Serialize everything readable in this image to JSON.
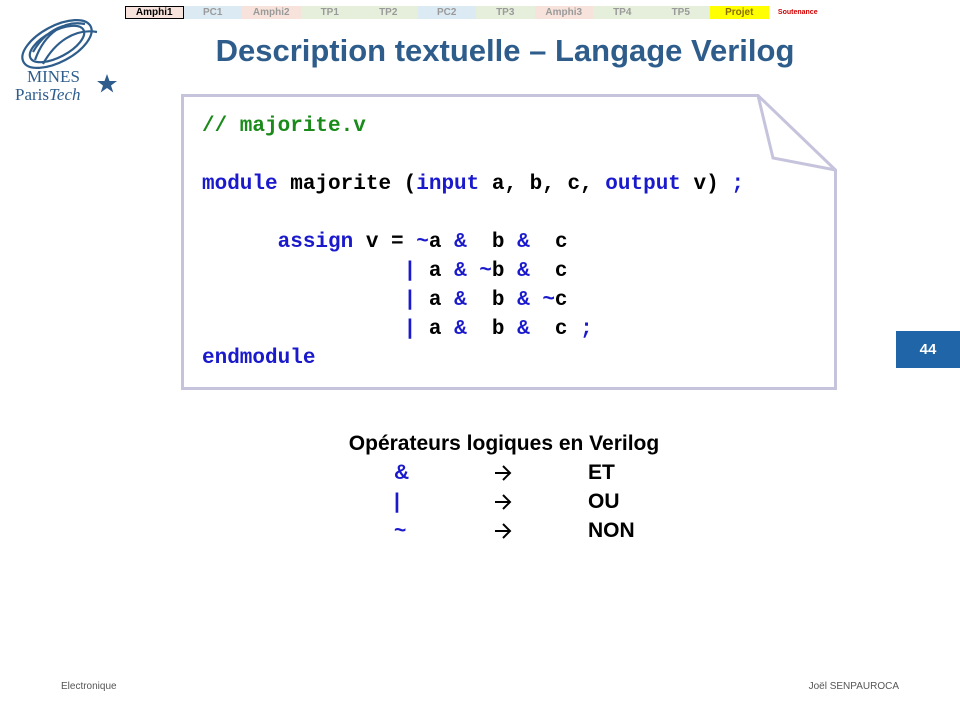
{
  "nav": {
    "tabs": [
      {
        "label": "Amphi1",
        "kind": "amphi",
        "active": true
      },
      {
        "label": "PC1",
        "kind": "pc"
      },
      {
        "label": "Amphi2",
        "kind": "amphi"
      },
      {
        "label": "TP1",
        "kind": "tp"
      },
      {
        "label": "TP2",
        "kind": "tp"
      },
      {
        "label": "PC2",
        "kind": "pc"
      },
      {
        "label": "TP3",
        "kind": "tp"
      },
      {
        "label": "Amphi3",
        "kind": "amphi"
      },
      {
        "label": "TP4",
        "kind": "tp"
      },
      {
        "label": "TP5",
        "kind": "tp"
      },
      {
        "label": "Projet",
        "kind": "projet"
      },
      {
        "label": "Soutenance",
        "kind": "sout"
      }
    ]
  },
  "logo": {
    "line1": "MINES",
    "line2a": "Paris",
    "line2b": "Tech",
    "color": "#2e5d8c"
  },
  "title": "Description textuelle – Langage Verilog",
  "code": {
    "comment": "// majorite.v",
    "l_module": "module",
    "l_modname": " majorite (",
    "l_input": "input",
    "l_args": " a, b, c, ",
    "l_output": "output",
    "l_v": " v) ",
    "l_semi": ";",
    "indent1": "      ",
    "assign": "assign",
    "assign_lhs": " v = ",
    "ops": {
      "not": "~",
      "and": "&",
      "or": "|",
      "semi": ";"
    },
    "endmodule": "endmodule"
  },
  "page_number": "44",
  "operators": {
    "title": "Opérateurs logiques en Verilog",
    "rows": [
      {
        "symbol": "&",
        "meaning": "ET"
      },
      {
        "symbol": "|",
        "meaning": "OU"
      },
      {
        "symbol": "~",
        "meaning": "NON"
      }
    ]
  },
  "footer": {
    "left": "Electronique",
    "right": "Joël SENPAUROCA"
  },
  "colors": {
    "title": "#2e5d8c",
    "keyword": "#1a1acc",
    "comment": "#1a8a1a",
    "page_badge": "#1f65a8"
  }
}
